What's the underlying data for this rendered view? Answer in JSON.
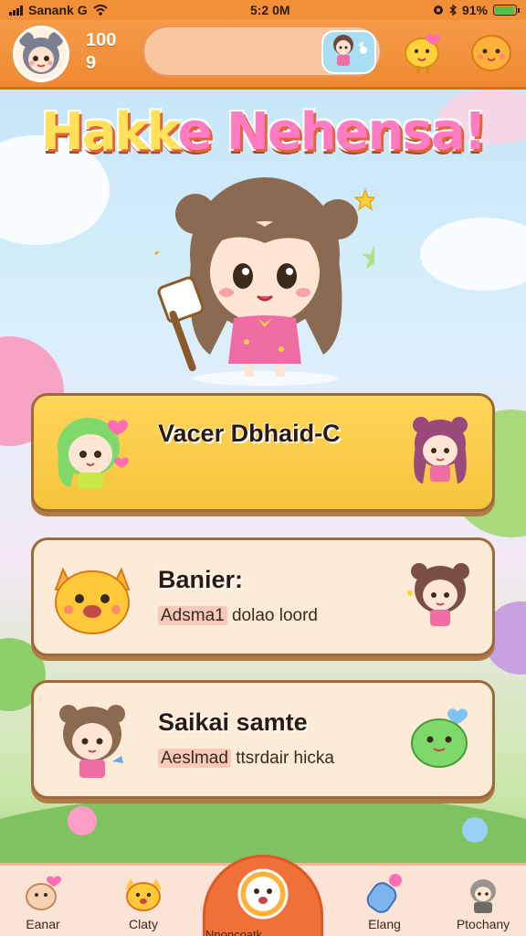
{
  "status_bar": {
    "carrier": "Sanank G",
    "time": "5:2 0M",
    "battery": "91%"
  },
  "top_bar": {
    "stat_1": "100",
    "stat_2": "9"
  },
  "title": {
    "part_1": "Hakk",
    "part_2": "e Nehensa!"
  },
  "cards": [
    {
      "title": "Vacer Dbhaid-C",
      "subtitle_highlight": "",
      "subtitle_rest": ""
    },
    {
      "title": "Banier:",
      "subtitle_highlight": "Adsma1",
      "subtitle_rest": " dolao loord"
    },
    {
      "title": "Saikai samte",
      "subtitle_highlight": "Aeslmad",
      "subtitle_rest": " ttsrdair hicka"
    }
  ],
  "bottom_nav": {
    "items": [
      {
        "label": "Eanar",
        "icon": "creature-icon"
      },
      {
        "label": "Claty",
        "icon": "cat-icon"
      },
      {
        "label": "Nnoncoatk",
        "icon": "home-mascot-icon"
      },
      {
        "label": "Elang",
        "icon": "potion-icon"
      },
      {
        "label": "Ptochany",
        "icon": "friend-icon"
      }
    ]
  },
  "colors": {
    "accent": "#f2903a",
    "card_highlight": "#ffd55a",
    "card_default": "#fcebd6"
  }
}
